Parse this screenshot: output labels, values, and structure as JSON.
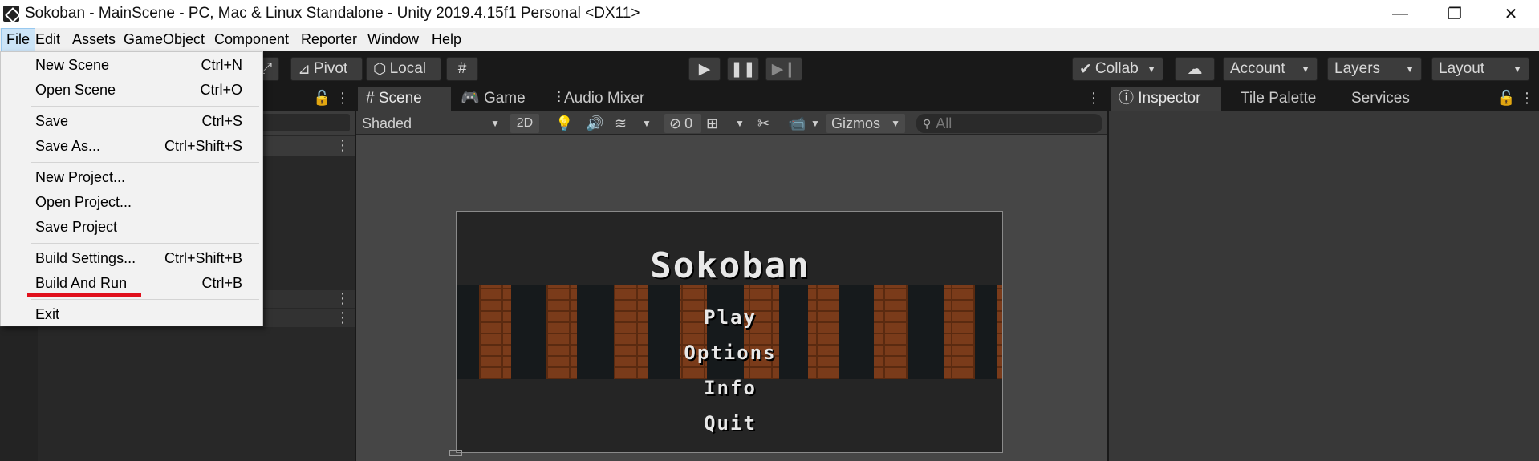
{
  "window": {
    "title": "Sokoban - MainScene - PC, Mac & Linux Standalone - Unity 2019.4.15f1 Personal <DX11>",
    "minimize_glyph": "—",
    "maximize_glyph": "❐",
    "close_glyph": "✕"
  },
  "menubar": {
    "items": [
      "File",
      "Edit",
      "Assets",
      "GameObject",
      "Component",
      "Reporter",
      "Window",
      "Help"
    ]
  },
  "toolbar": {
    "pivot": "Pivot",
    "local": "Local",
    "collab": "Collab",
    "account": "Account",
    "layers": "Layers",
    "layout": "Layout"
  },
  "file_menu": {
    "items": [
      {
        "label": "New Scene",
        "shortcut": "Ctrl+N"
      },
      {
        "label": "Open Scene",
        "shortcut": "Ctrl+O"
      },
      {
        "label": "Save",
        "shortcut": "Ctrl+S"
      },
      {
        "label": "Save As...",
        "shortcut": "Ctrl+Shift+S"
      },
      {
        "label": "New Project...",
        "shortcut": ""
      },
      {
        "label": "Open Project...",
        "shortcut": ""
      },
      {
        "label": "Save Project",
        "shortcut": ""
      },
      {
        "label": "Build Settings...",
        "shortcut": "Ctrl+Shift+B"
      },
      {
        "label": "Build And Run",
        "shortcut": "Ctrl+B"
      },
      {
        "label": "Exit",
        "shortcut": ""
      }
    ]
  },
  "center_tabs": [
    "Scene",
    "Game",
    "Audio Mixer"
  ],
  "scene_toolbar": {
    "shading_mode": "Shaded",
    "mode_2d": "2D",
    "hidden_count": "0",
    "gizmos": "Gizmos",
    "search_placeholder": "All"
  },
  "right_tabs": [
    "Inspector",
    "Tile Palette",
    "Services"
  ],
  "game": {
    "title": "Sokoban",
    "menu": [
      "Play",
      "Options",
      "Info",
      "Quit"
    ]
  },
  "colors": {
    "highlight_underline": "#e0101c",
    "brick": "#7a3b1a"
  }
}
